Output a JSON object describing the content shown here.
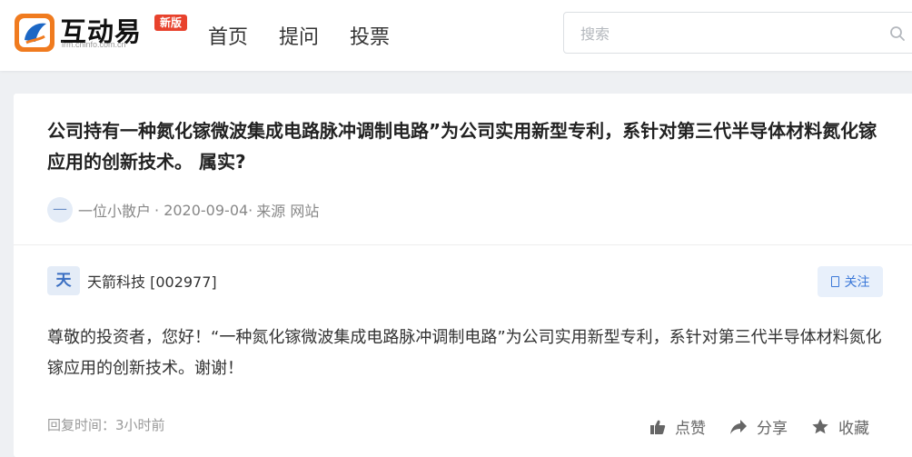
{
  "header": {
    "logo_text": "互动易",
    "logo_sub": "irm.cninfo.com.cn",
    "badge": "新版",
    "nav": [
      {
        "label": "首页"
      },
      {
        "label": "提问"
      },
      {
        "label": "投票"
      }
    ],
    "search": {
      "placeholder": "搜索",
      "value": ""
    }
  },
  "question": {
    "title": "公司持有一种氮化镓微波集成电路脉冲调制电路”为公司实用新型专利，系针对第三代半导体材料氮化镓应用的创新技术。 属实?",
    "author_avatar": "—",
    "author": "一位小散户",
    "date": "· 2020-09-04·",
    "source": "来源 网站"
  },
  "answer": {
    "company_avatar": "天",
    "company": "天箭科技 [002977]",
    "follow_label": "关注",
    "text": "尊敬的投资者，您好！“一种氮化镓微波集成电路脉冲调制电路”为公司实用新型专利，系针对第三代半导体材料氮化镓应用的创新技术。谢谢！",
    "reply_time": "回复时间：3小时前",
    "actions": {
      "like": "点赞",
      "share": "分享",
      "favorite": "收藏"
    }
  },
  "colors": {
    "accent": "#3b78d8",
    "badge": "#e8422d",
    "logo_orange": "#f07b1f"
  }
}
